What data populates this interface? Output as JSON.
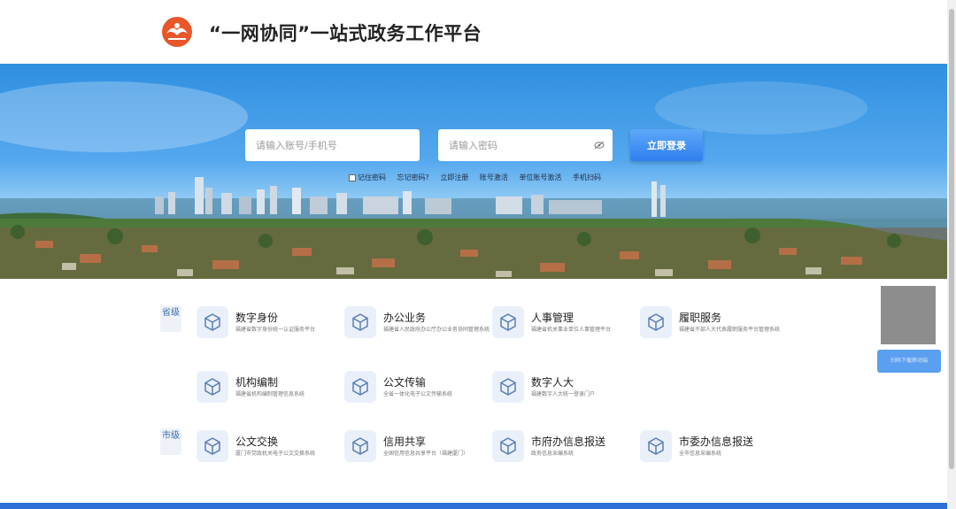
{
  "header": {
    "title": "“一网协同”一站式政务工作平台"
  },
  "login": {
    "username_placeholder": "请输入账号/手机号",
    "password_placeholder": "请输入密码",
    "submit_label": "立即登录",
    "links": [
      "记住密码",
      "忘记密码?",
      "立即注册",
      "账号激活",
      "单位账号激活",
      "手机扫码"
    ]
  },
  "sections": [
    {
      "level": "省级",
      "services": [
        {
          "name": "数字身份",
          "desc": "福建省数字身份统一认证服务平台"
        },
        {
          "name": "办公业务",
          "desc": "福建省人民政府办公厅办公业务协同管理系统"
        },
        {
          "name": "人事管理",
          "desc": "福建省机关事业单位人事管理平台"
        },
        {
          "name": "履职服务",
          "desc": "福建省干部人大代表履职服务平台管理系统"
        },
        {
          "name": "机构编制",
          "desc": "福建省机构编制管理信息系统"
        },
        {
          "name": "公文传输",
          "desc": "全省一体化电子公文传输系统"
        },
        {
          "name": "数字人大",
          "desc": "福建数字人大统一登录门户"
        }
      ]
    },
    {
      "level": "市级",
      "services": [
        {
          "name": "公文交换",
          "desc": "厦门市党政机关电子公文交换系统"
        },
        {
          "name": "信用共享",
          "desc": "全国信用信息共享平台（福建厦门）"
        },
        {
          "name": "市府办信息报送",
          "desc": "政务信息采编系统"
        },
        {
          "name": "市委办信息报送",
          "desc": "全市信息采编系统"
        }
      ]
    }
  ],
  "qr": {
    "button_label": "扫码下载移动端"
  },
  "colors": {
    "accent": "#2f7ff0",
    "footer": "#2d6fd6",
    "icon_bg": "#eaf0fa"
  },
  "icons": {
    "logo": "logo-icon",
    "service": "cube-icon",
    "password": "eye-icon"
  }
}
